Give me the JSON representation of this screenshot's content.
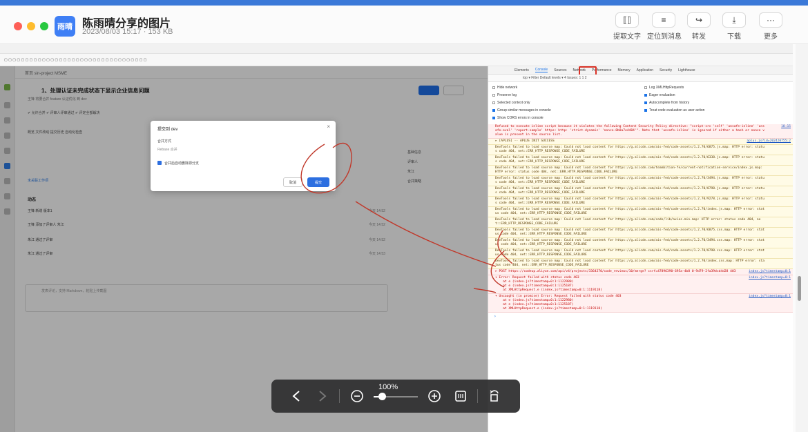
{
  "viewer": {
    "avatar_label": "雨晴",
    "title": "陈雨晴分享的图片",
    "meta": "2023/08/03 15:17 · 153 KB",
    "actions": [
      {
        "label": "提取文字",
        "icon": "⟦⟧"
      },
      {
        "label": "定位到消息",
        "icon": "≡"
      },
      {
        "label": "转发",
        "icon": "↪"
      },
      {
        "label": "下载",
        "icon": "⤓"
      },
      {
        "label": "更多",
        "icon": "···"
      }
    ]
  },
  "zoom": {
    "percent_label": "100%",
    "level": 0.18
  },
  "screenshot": {
    "app": {
      "breadcrumb": "首页   sin-project   MSME",
      "title": "1、处理认证未完成状态下显示企业信息问题",
      "subtitle": "王锋 将要合并 feature 认证优化 到 dev",
      "checks": "✔ 允许合并    ✔ 评审人评审通过    ✔ 评定全部解决",
      "tabs": "概览    文件改动    提交历史    自动化检查",
      "right_info_1": "基础信息",
      "right_info_2": "评审人",
      "right_info_3": "朱江",
      "right_info_4": "合并策略",
      "unlinked": "未关联工作项",
      "activity_title": "动态",
      "activities": [
        {
          "text": "王锋  新增  版本1",
          "time": "今天 14:52"
        },
        {
          "text": "王锋  添加了评审人  朱江",
          "time": "今天 14:52"
        },
        {
          "text": "朱江  通过了评审",
          "time": "今天 14:52"
        },
        {
          "text": "朱江  通过了评审",
          "time": "今天 14:53"
        }
      ],
      "comment_placeholder": "发表评论，支持 Markdown，粘贴上传截图"
    },
    "dialog": {
      "title": "提交到 dev",
      "close": "×",
      "method_label": "合并方式",
      "method_option": "Rebase 合并",
      "delete_branch_label": "合并后自动删除源分支",
      "cancel": "取消",
      "submit": "提交"
    },
    "devtools": {
      "tabs": [
        "Elements",
        "Console",
        "Sources",
        "Network",
        "Performance",
        "Memory",
        "Application",
        "Security",
        "Lighthouse"
      ],
      "toolbar": "top ▾   Filter                                              Default levels ▾   4 Issues: 1  1  2",
      "settings_left": [
        "Hide network",
        "Preserve log",
        "Selected context only",
        "Group similar messages in console",
        "Show CORS errors in console"
      ],
      "settings_right": [
        "Log XMLHttpRequests",
        "Eager evaluation",
        "Autocomplete from history",
        "Treat code evaluation as user action"
      ],
      "console_rows": [
        {
          "type": "error",
          "text": "Refused to execute inline script because it violates the following Content Security Policy directive: \"script-src 'self' 'unsafe-inline' 'unsafe-eval' 'report-sample' https: http: 'strict-dynamic' 'nonce-8b8a7e4484'\". Note that 'unsafe-inline' is ignored if either a hash or nonce value is present in the source list.",
          "src": "18:15"
        },
        {
          "type": "warn",
          "text": "▸ [APLUS] -- APLUS INIT SUCCESS",
          "src": "aplus.js?id=202420755:2"
        },
        {
          "type": "warn",
          "text": "DevTools failed to load source map: Could not load content for https://g.alicdn.com/ais-fed/code-assets/1.2.70/6875.js.map: HTTP error: status code 404, net::ERR_HTTP_RESPONSE_CODE_FAILURE",
          "src": ""
        },
        {
          "type": "warn",
          "text": "DevTools failed to load source map: Could not load content for https://g.alicdn.com/ais-fed/code-assets/1.2.70/6338.js.map: HTTP error: status code 404, net::ERR_HTTP_RESPONSE_CODE_FAILURE",
          "src": ""
        },
        {
          "type": "warn",
          "text": "DevTools failed to load source map: Could not load content for https://g.alicdn.com/teambition-fe/current-notification-service/index.js.map: HTTP error: status code 404, net::ERR_HTTP_RESPONSE_CODE_FAILURE",
          "src": ""
        },
        {
          "type": "warn",
          "text": "DevTools failed to load source map: Could not load content for https://g.alicdn.com/ais-fed/code-assets/1.2.70/3494.js.map: HTTP error: status code 404, net::ERR_HTTP_RESPONSE_CODE_FAILURE",
          "src": ""
        },
        {
          "type": "warn",
          "text": "DevTools failed to load source map: Could not load content for https://g.alicdn.com/ais-fed/code-assets/1.2.70/8798.js.map: HTTP error: status code 404, net::ERR_HTTP_RESPONSE_CODE_FAILURE",
          "src": ""
        },
        {
          "type": "warn",
          "text": "DevTools failed to load source map: Could not load content for https://g.alicdn.com/ais-fed/code-assets/1.2.70/9278.js.map: HTTP error: status code 404, net::ERR_HTTP_RESPONSE_CODE_FAILURE",
          "src": ""
        },
        {
          "type": "warn",
          "text": "DevTools failed to load source map: Could not load content for https://g.alicdn.com/ais-fed/code-assets/1.2.70/index.js.map: HTTP error: status code 404, net::ERR_HTTP_RESPONSE_CODE_FAILURE",
          "src": ""
        },
        {
          "type": "warn",
          "text": "DevTools failed to load source map: Could not load content for https://g.alicdn.com/code/lib/axios.min.map: HTTP error: status code 404, net::ERR_HTTP_RESPONSE_CODE_FAILURE",
          "src": ""
        },
        {
          "type": "warn",
          "text": "DevTools failed to load source map: Could not load content for https://g.alicdn.com/ais-fed/code-assets/1.2.70/6875.css.map: HTTP error: status code 404, net::ERR_HTTP_RESPONSE_CODE_FAILURE",
          "src": ""
        },
        {
          "type": "warn",
          "text": "DevTools failed to load source map: Could not load content for https://g.alicdn.com/ais-fed/code-assets/1.2.70/3494.css.map: HTTP error: status code 404, net::ERR_HTTP_RESPONSE_CODE_FAILURE",
          "src": ""
        },
        {
          "type": "warn",
          "text": "DevTools failed to load source map: Could not load content for https://g.alicdn.com/ais-fed/code-assets/1.2.70/8798.css.map: HTTP error: status code 404, net::ERR_HTTP_RESPONSE_CODE_FAILURE",
          "src": ""
        },
        {
          "type": "warn",
          "text": "DevTools failed to load source map: Could not load content for https://g.alicdn.com/ais-fed/code-assets/1.2.70/index.css.map: HTTP error: status code 404, net::ERR_HTTP_RESPONSE_CODE_FAILURE",
          "src": ""
        },
        {
          "type": "error",
          "text": "▸ POST https://codeup.aliyun.com/api/v4/projects/3364270/code_reviews/10/merge? csrf=47896390-695a-4b8 0-9d79-2fa39dcd4d28 403",
          "src": "index.js?timestamp=0:1"
        },
        {
          "type": "error",
          "text": "▾ Error: Request failed with status code 403\n    at e (index.js?timestamp=0:1:1122980)\n    at e (index.js?timestamp=0:1:1125187)\n    at XMLHttpRequest.e (index.js?timestamp=0:1:1119118)",
          "src": "index.js?timestamp=0:1"
        },
        {
          "type": "error",
          "text": "▾ Uncaught (in promise) Error: Request failed with status code 403\n    at e (index.js?timestamp=0:1:1122980)\n    at e (index.js?timestamp=0:1:1125187)\n    at XMLHttpRequest.e (index.js?timestamp=0:1:1119118)",
          "src": "index.js?timestamp=0:1"
        }
      ]
    }
  }
}
